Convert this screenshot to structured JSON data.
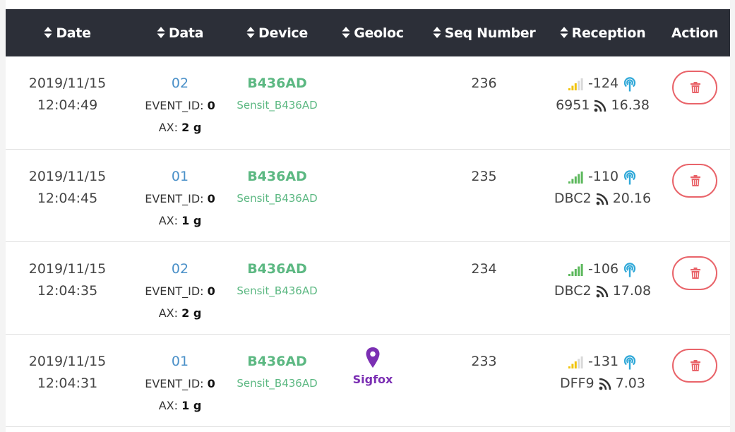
{
  "columns": [
    {
      "label": "Date",
      "sortable": true
    },
    {
      "label": "Data",
      "sortable": true
    },
    {
      "label": "Device",
      "sortable": true
    },
    {
      "label": "Geoloc",
      "sortable": true
    },
    {
      "label": "Seq Number",
      "sortable": true
    },
    {
      "label": "Reception",
      "sortable": true
    },
    {
      "label": "Action",
      "sortable": false
    }
  ],
  "rows": [
    {
      "date": "2019/11/15",
      "time": "12:04:49",
      "data": "02",
      "event_id_label": "EVENT_ID:",
      "event_id": "0",
      "ax_label": "AX:",
      "ax": "2 g",
      "device_id": "B436AD",
      "device_name": "Sensit_B436AD",
      "geoloc": "",
      "seq": "236",
      "rssi": "-124",
      "signal_level": 3,
      "signal_color": "#f1c40f",
      "station": "6951",
      "snr": "16.38"
    },
    {
      "date": "2019/11/15",
      "time": "12:04:45",
      "data": "01",
      "event_id_label": "EVENT_ID:",
      "event_id": "0",
      "ax_label": "AX:",
      "ax": "1 g",
      "device_id": "B436AD",
      "device_name": "Sensit_B436AD",
      "geoloc": "",
      "seq": "235",
      "rssi": "-110",
      "signal_level": 5,
      "signal_color": "#5cb85c",
      "station": "DBC2",
      "snr": "20.16"
    },
    {
      "date": "2019/11/15",
      "time": "12:04:35",
      "data": "02",
      "event_id_label": "EVENT_ID:",
      "event_id": "0",
      "ax_label": "AX:",
      "ax": "2 g",
      "device_id": "B436AD",
      "device_name": "Sensit_B436AD",
      "geoloc": "",
      "seq": "234",
      "rssi": "-106",
      "signal_level": 5,
      "signal_color": "#5cb85c",
      "station": "DBC2",
      "snr": "17.08"
    },
    {
      "date": "2019/11/15",
      "time": "12:04:31",
      "data": "01",
      "event_id_label": "EVENT_ID:",
      "event_id": "0",
      "ax_label": "AX:",
      "ax": "1 g",
      "device_id": "B436AD",
      "device_name": "Sensit_B436AD",
      "geoloc": "Sigfox",
      "seq": "233",
      "rssi": "-131",
      "signal_level": 3,
      "signal_color": "#f1c40f",
      "station": "DFF9",
      "snr": "7.03"
    }
  ],
  "colors": {
    "header_bg": "#2c2f38",
    "data_blue": "#4a90c8",
    "device_green": "#5cb882",
    "geoloc_purple": "#7b2fb3",
    "antenna_blue": "#2fa8d8",
    "delete_red": "#e9646a",
    "signal_dim": "#d9d9d9"
  },
  "icons": {
    "sort": "sort-both-icon",
    "signal": "signal-bars-icon",
    "antenna": "antenna-icon",
    "snr": "rss-wave-icon",
    "location": "map-marker-icon",
    "delete": "trash-icon"
  }
}
